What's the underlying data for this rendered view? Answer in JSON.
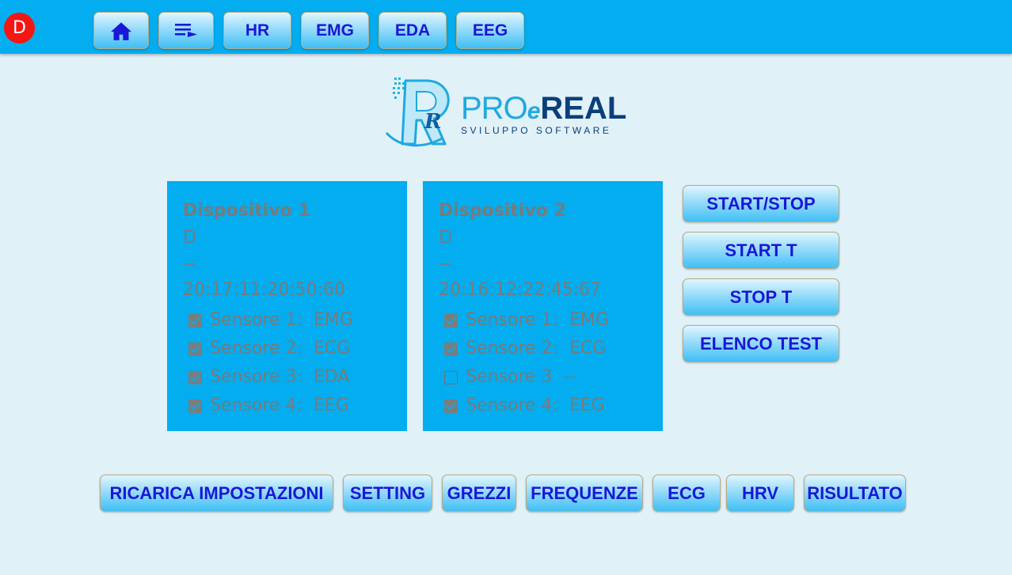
{
  "topbar": {
    "avatar_letter": "D",
    "tabs": [
      {
        "label": "HR"
      },
      {
        "label": "EMG"
      },
      {
        "label": "EDA"
      },
      {
        "label": "EEG"
      }
    ],
    "home_icon": "home-icon",
    "list_icon": "playlist-icon"
  },
  "logo": {
    "brand_a": "PRO",
    "brand_e": "e",
    "brand_b": "REAL",
    "tagline": "SVILUPPO SOFTWARE"
  },
  "devices": [
    {
      "title": "Dispositivo 1",
      "code": "D",
      "status": "--",
      "id": "20:17:11:20:50:60",
      "sensors": [
        {
          "label": "Sensore 1:  EMG",
          "checked": true
        },
        {
          "label": "Sensore 2:  ECG",
          "checked": true
        },
        {
          "label": "Sensore 3:  EDA",
          "checked": true
        },
        {
          "label": "Sensore 4:  EEG",
          "checked": true
        }
      ]
    },
    {
      "title": "Dispositivo 2",
      "code": "D",
      "status": "--",
      "id": "20:16:12:22:45:67",
      "sensors": [
        {
          "label": "Sensore 1:  EMG",
          "checked": true
        },
        {
          "label": "Sensore 2:  ECG",
          "checked": true
        },
        {
          "label": "Sensore 3  --",
          "checked": false
        },
        {
          "label": "Sensore 4:  EEG",
          "checked": true
        }
      ]
    }
  ],
  "side_buttons": {
    "start_stop": "START/STOP",
    "start_t": "START T",
    "stop_t": "STOP T",
    "elenco_test": "ELENCO TEST"
  },
  "bottom_buttons": {
    "ricarica": "RICARICA IMPOSTAZIONI",
    "setting": "SETTING",
    "grezzi": "GREZZI",
    "frequenze": "FREQUENZE",
    "ecg": "ECG",
    "hrv": "HRV",
    "risultato": "RISULTATO"
  },
  "colors": {
    "topbar": "#03adef",
    "background": "#e1f1f8",
    "button_text": "#1a17d6",
    "avatar": "#f41613",
    "device_text": "#7a7a7a"
  }
}
